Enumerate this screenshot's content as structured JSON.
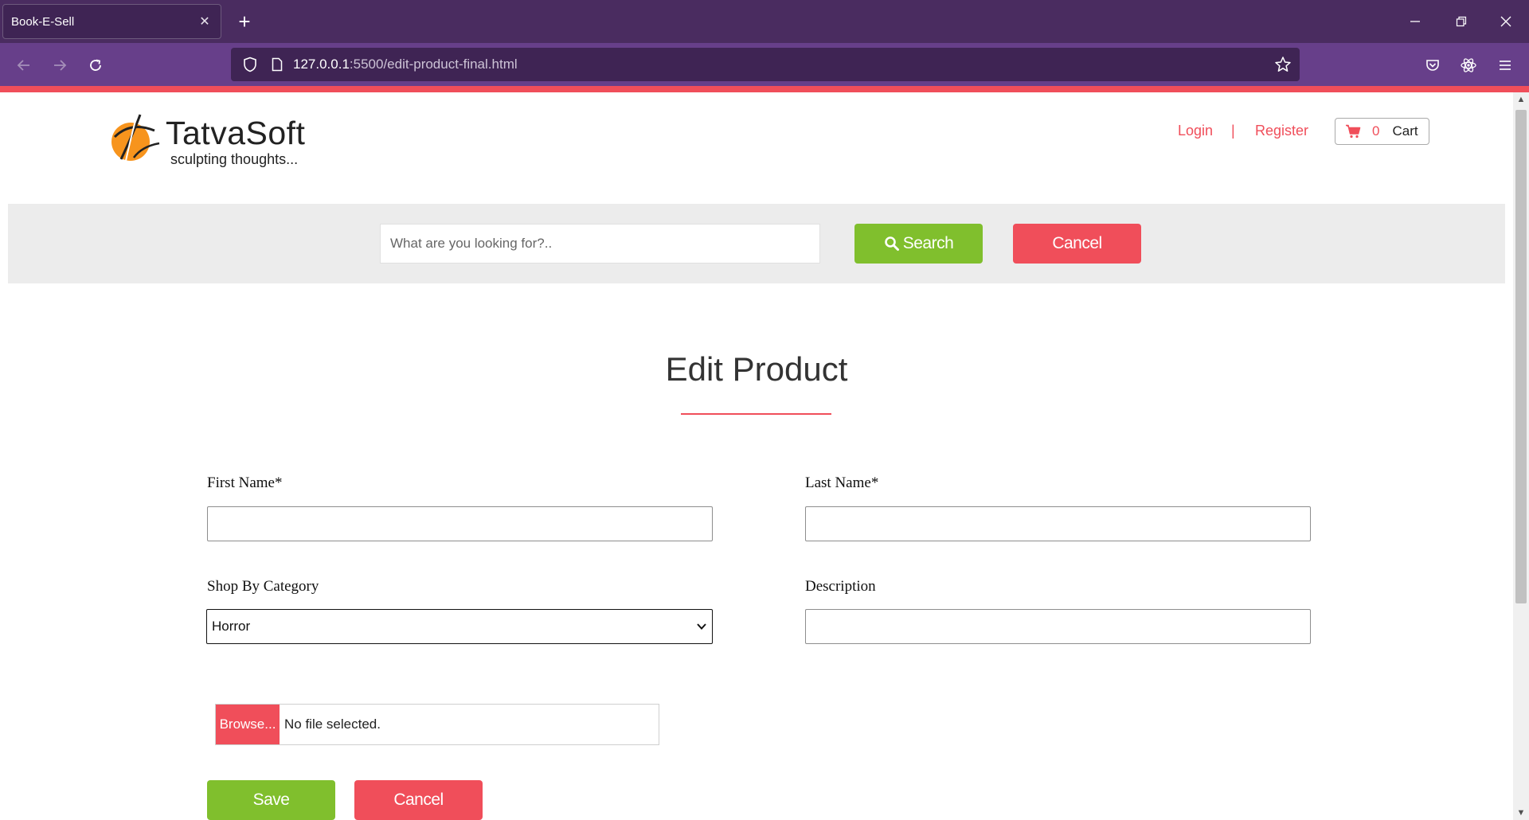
{
  "browser": {
    "tab_title": "Book-E-Sell",
    "tab_close": "✕",
    "new_tab": "+",
    "url_host": "127.0.0.1",
    "url_path": ":5500/edit-product-final.html"
  },
  "header": {
    "logo_name": "TatvaSoft",
    "logo_tagline": "sculpting thoughts...",
    "login_label": "Login",
    "separator": "|",
    "register_label": "Register",
    "cart_count": "0",
    "cart_label": "Cart"
  },
  "search": {
    "placeholder": "What are you looking for?..",
    "search_label": "Search",
    "cancel_label": "Cancel"
  },
  "main": {
    "title": "Edit Product"
  },
  "form": {
    "first_name_label": "First Name*",
    "last_name_label": "Last Name*",
    "category_label": "Shop By Category",
    "category_value": "Horror",
    "description_label": "Description",
    "browse_label": "Browse...",
    "file_status": "No file selected.",
    "save_label": "Save",
    "cancel_label": "Cancel"
  },
  "colors": {
    "accent_red": "#f04e5a",
    "accent_green": "#80bf2d",
    "chrome_purple": "#673f8a",
    "tabbar_purple": "#4a2c60"
  }
}
